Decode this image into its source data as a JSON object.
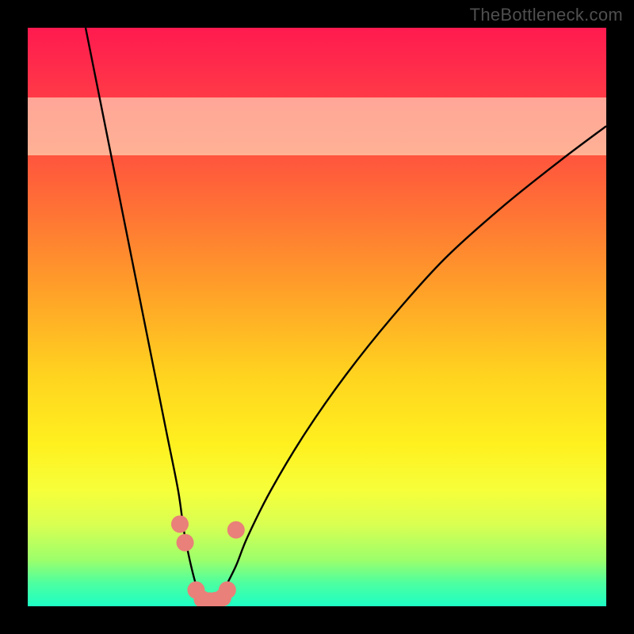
{
  "watermark": "TheBottleneck.com",
  "chart_data": {
    "type": "line",
    "title": "",
    "xlabel": "",
    "ylabel": "",
    "xlim": [
      0,
      100
    ],
    "ylim": [
      0,
      100
    ],
    "series": [
      {
        "name": "curve",
        "x": [
          10,
          14,
          18,
          22,
          24,
          26,
          27,
          28,
          29,
          30,
          31,
          32,
          33,
          34,
          36,
          38,
          42,
          48,
          55,
          63,
          72,
          82,
          92,
          100
        ],
        "y": [
          100,
          80,
          60,
          40,
          30,
          20,
          13,
          8,
          4,
          1,
          0,
          0,
          1,
          3,
          7,
          12,
          20,
          30,
          40,
          50,
          60,
          69,
          77,
          83
        ]
      }
    ],
    "markers": {
      "name": "highlight-points",
      "x": [
        26.3,
        27.2,
        29.1,
        30.2,
        31.4,
        32.5,
        33.7,
        34.5,
        36.0
      ],
      "y": [
        14.2,
        11.0,
        2.8,
        1.2,
        0.9,
        1.0,
        1.5,
        2.8,
        13.2
      ],
      "color": "#e98079",
      "size": 11
    },
    "background_gradient": {
      "orientation": "vertical",
      "stops": [
        {
          "pos": 0.0,
          "color": "#ff1a4f"
        },
        {
          "pos": 0.2,
          "color": "#ff4e3f"
        },
        {
          "pos": 0.46,
          "color": "#ffa228"
        },
        {
          "pos": 0.72,
          "color": "#fff01f"
        },
        {
          "pos": 0.92,
          "color": "#9cff6b"
        },
        {
          "pos": 1.0,
          "color": "#1dffc4"
        }
      ]
    },
    "pale_band_y": [
      78,
      88
    ]
  }
}
